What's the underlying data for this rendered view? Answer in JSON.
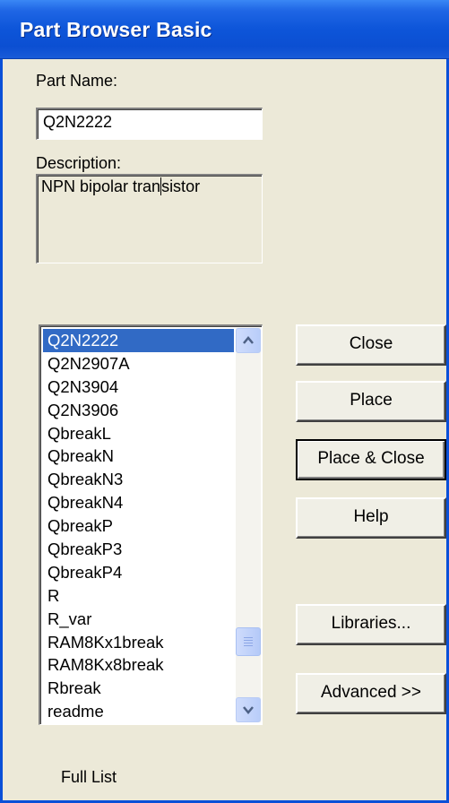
{
  "window": {
    "title": "Part Browser Basic"
  },
  "part_name": {
    "label": "Part Name:",
    "value": "Q2N2222"
  },
  "description": {
    "label": "Description:",
    "text_before_caret": "NPN bipolar tran",
    "text_after_caret": "sistor"
  },
  "parts_list": {
    "selected": "Q2N2222",
    "items": [
      "Q2N2222",
      "Q2N2907A",
      "Q2N3904",
      "Q2N3906",
      "QbreakL",
      "QbreakN",
      "QbreakN3",
      "QbreakN4",
      "QbreakP",
      "QbreakP3",
      "QbreakP4",
      "R",
      "R_var",
      "RAM8Kx1break",
      "RAM8Kx8break",
      "Rbreak",
      "readme"
    ]
  },
  "buttons": {
    "close": "Close",
    "place": "Place",
    "place_close": "Place & Close",
    "help": "Help",
    "libraries": "Libraries...",
    "advanced": "Advanced >>"
  },
  "status": {
    "text": "Full List"
  },
  "colors": {
    "titlebar": "#0d55d9",
    "selection": "#316ac5",
    "dialog_bg": "#ece9d8"
  }
}
